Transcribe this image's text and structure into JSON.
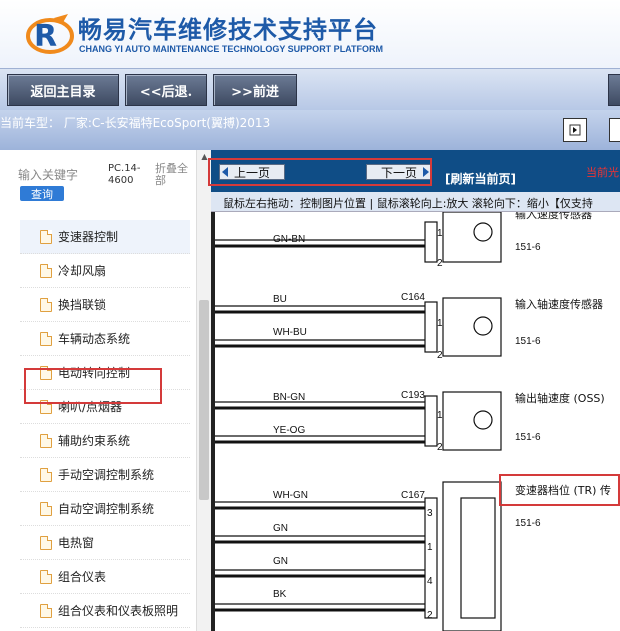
{
  "header": {
    "title": "畅易汽车维修技术支持平台",
    "subtitle": "CHANG YI AUTO MAINTENANCE TECHNOLOGY SUPPORT PLATFORM"
  },
  "nav": {
    "home_label": "返回主目录",
    "back_label": "<<后退.",
    "forward_label": ">>前进"
  },
  "car": {
    "model_text": "当前车型：  厂家:C-长安福特EcoSport(翼搏)2013"
  },
  "sidebar": {
    "search_label": "输入关键字",
    "search_button": "查询",
    "pc_code": "PC.14-4600",
    "collapse_label": "折叠全部",
    "items": [
      {
        "label": "变速器控制",
        "selected": true
      },
      {
        "label": "冷却风扇"
      },
      {
        "label": "换挡联锁"
      },
      {
        "label": "车辆动态系统"
      },
      {
        "label": "电动转向控制"
      },
      {
        "label": "喇叭/点烟器"
      },
      {
        "label": "辅助约束系统"
      },
      {
        "label": "手动空调控制系统"
      },
      {
        "label": "自动空调控制系统"
      },
      {
        "label": "电热窗"
      },
      {
        "label": "组合仪表"
      },
      {
        "label": "组合仪表和仪表板照明"
      }
    ]
  },
  "main": {
    "prev_page": "上一页",
    "next_page": "下一页",
    "refresh": "[刷新当前页]",
    "current_label": "当前光",
    "hint": "鼠标左右拖动：控制图片位置 | 鼠标滚轮向上:放大  滚轮向下：缩小【仅支持"
  },
  "diagram": {
    "wires": [
      {
        "label": "GN-BN"
      },
      {
        "label": "BU"
      },
      {
        "label": "WH-BU"
      },
      {
        "label": "BN-GN"
      },
      {
        "label": "YE-OG"
      },
      {
        "label": "WH-GN"
      },
      {
        "label": "GN"
      },
      {
        "label": "GN"
      },
      {
        "label": "BK"
      }
    ],
    "connectors": [
      "C164",
      "C193",
      "C167"
    ],
    "components": [
      {
        "name": "输入速度传感器"
      },
      {
        "name": "输入轴速度传感器"
      },
      {
        "name": "输出轴速度 (OSS)"
      },
      {
        "name": "变速器档位 (TR) 传"
      }
    ],
    "refs": [
      "151-6",
      "151-6",
      "151-6",
      "151-6"
    ],
    "pins": [
      "1",
      "2",
      "1",
      "2",
      "1",
      "2",
      "3",
      "1",
      "4",
      "2"
    ]
  }
}
